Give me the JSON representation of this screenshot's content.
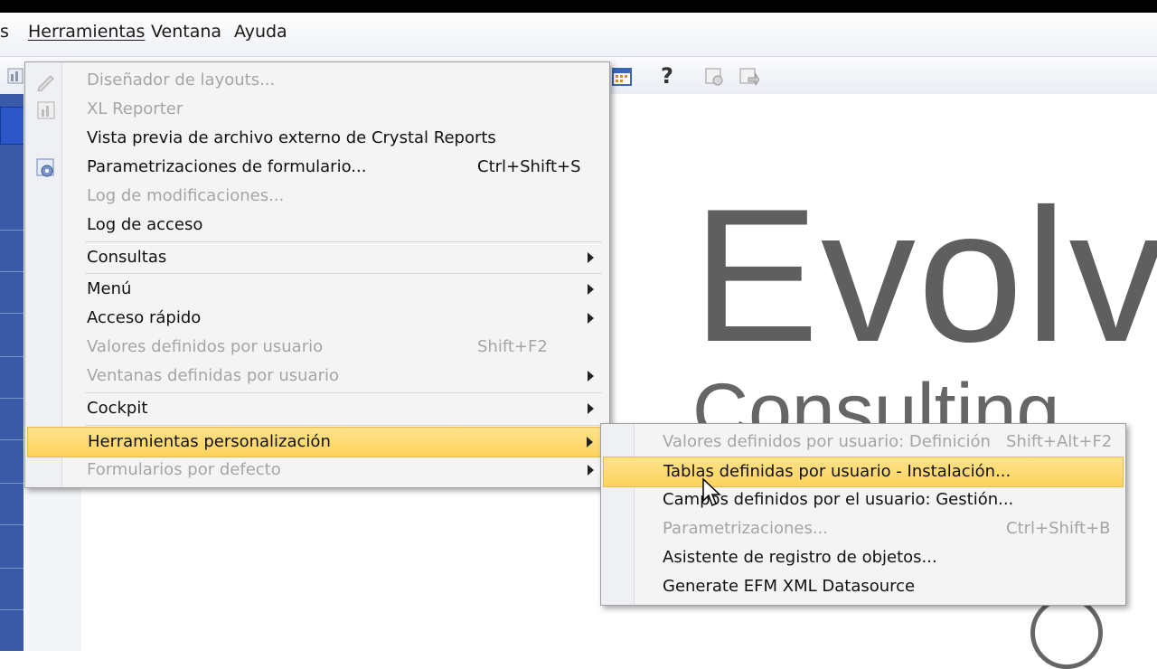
{
  "menubar": {
    "items": [
      "s",
      "Herramientas",
      "Ventana",
      "Ayuda"
    ]
  },
  "main_menu": {
    "items": [
      {
        "label": "Diseñador de layouts...",
        "shortcut": "",
        "disabled": true
      },
      {
        "label": "XL Reporter",
        "shortcut": "",
        "disabled": true
      },
      {
        "label": "Vista previa de archivo externo de Crystal Reports",
        "shortcut": "",
        "disabled": false
      },
      {
        "label": "Parametrizaciones de formulario...",
        "shortcut": "Ctrl+Shift+S",
        "disabled": false
      },
      {
        "label": "Log de modificaciones...",
        "shortcut": "",
        "disabled": true
      },
      {
        "label": "Log de acceso",
        "shortcut": "",
        "disabled": false
      },
      {
        "label": "Consultas",
        "shortcut": "",
        "disabled": false
      },
      {
        "label": "Menú",
        "shortcut": "",
        "disabled": false
      },
      {
        "label": "Acceso rápido",
        "shortcut": "",
        "disabled": false
      },
      {
        "label": "Valores definidos por usuario",
        "shortcut": "Shift+F2",
        "disabled": true
      },
      {
        "label": "Ventanas definidas por usuario",
        "shortcut": "",
        "disabled": true
      },
      {
        "label": "Cockpit",
        "shortcut": "",
        "disabled": false
      },
      {
        "label": "Herramientas personalización",
        "shortcut": "",
        "disabled": false,
        "highlighted": true
      },
      {
        "label": "Formularios por defecto",
        "shortcut": "",
        "disabled": true
      }
    ]
  },
  "submenu": {
    "items": [
      {
        "label": "Valores definidos por usuario: Definición",
        "shortcut": "Shift+Alt+F2",
        "disabled": true
      },
      {
        "label": "Tablas definidas por usuario - Instalación...",
        "shortcut": "",
        "disabled": false,
        "highlighted": true
      },
      {
        "label": "Campos definidos por el usuario: Gestión...",
        "shortcut": "",
        "disabled": false
      },
      {
        "label": "Parametrizaciones...",
        "shortcut": "Ctrl+Shift+B",
        "disabled": true
      },
      {
        "label": "Asistente de registro de objetos...",
        "shortcut": "",
        "disabled": false
      },
      {
        "label": "Generate EFM XML Datasource",
        "shortcut": "",
        "disabled": false
      }
    ]
  },
  "background": {
    "logo_main": "Evolv",
    "logo_sub": "Consulting"
  },
  "toolbar": {
    "help_glyph": "?"
  },
  "colors": {
    "highlight": "#fdd35d",
    "disabled_text": "#a5a5a5",
    "left_pane": "#3a5aa8"
  }
}
